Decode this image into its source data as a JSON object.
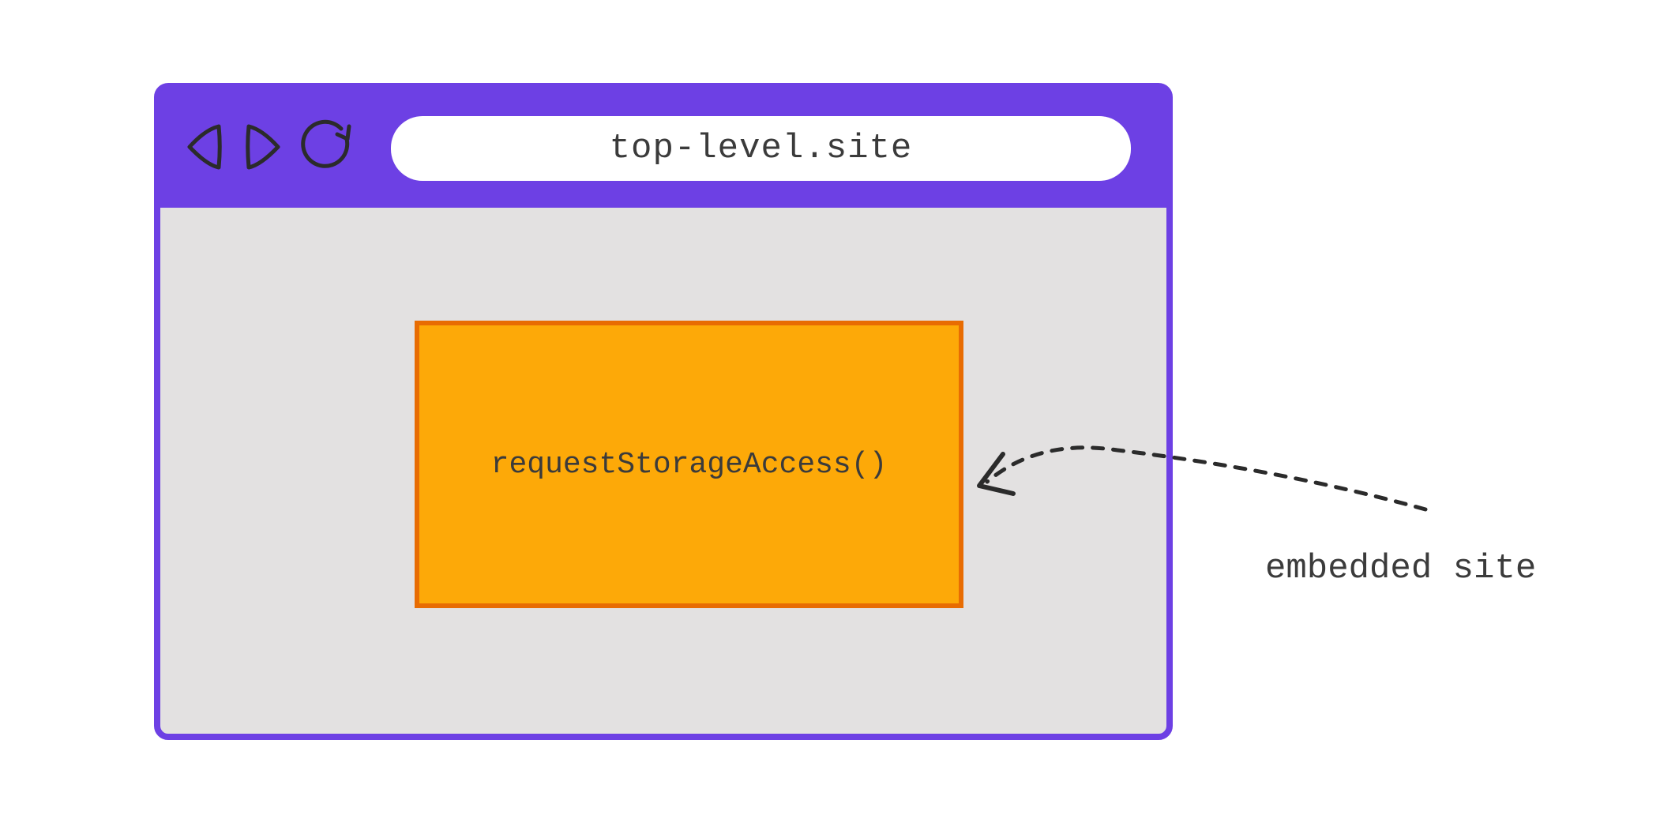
{
  "browser": {
    "address_url": "top-level.site",
    "icons": {
      "back": "back-icon",
      "forward": "forward-icon",
      "refresh": "refresh-icon"
    }
  },
  "embedded": {
    "api_call": "requestStorageAccess()"
  },
  "annotation": {
    "label": "embedded site"
  },
  "colors": {
    "toolbar_purple": "#6d40e4",
    "embed_fill": "#fda908",
    "embed_border": "#e86c02",
    "viewport_grey": "#e3e1e1",
    "stroke_dark": "#3b3b3b"
  }
}
